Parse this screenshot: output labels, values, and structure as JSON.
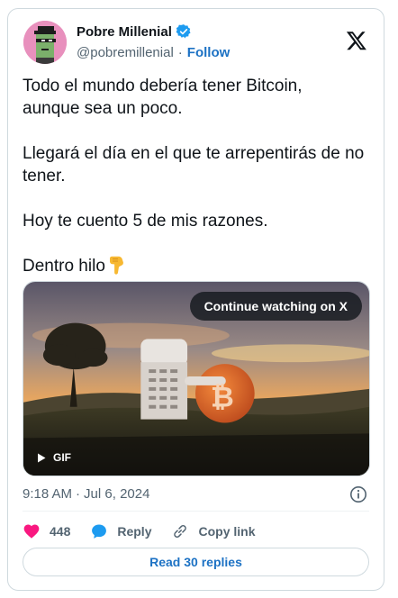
{
  "author": {
    "name": "Pobre Millenial",
    "handle": "@pobremillenial",
    "separator": "·",
    "follow_label": "Follow",
    "verified": true,
    "avatar_icon": "pixel-art-avatar"
  },
  "tweet": {
    "paragraphs": [
      "Todo el mundo debería tener Bitcoin,\naunque sea un poco.",
      "Llegará el día en el que te arrepentirás de no\ntener.",
      "Hoy te cuento 5 de mis razones.",
      "Dentro hilo"
    ],
    "emoji": "backhand-index-pointing-down"
  },
  "media": {
    "type": "gif",
    "gif_label": "GIF",
    "continue_label": "Continue watching on X",
    "description_icon": "bitcoin-coin-scene"
  },
  "meta": {
    "time": "9:18 AM",
    "date_separator": "·",
    "date": "Jul 6, 2024"
  },
  "actions": {
    "likes_count": "448",
    "reply_label": "Reply",
    "copy_link_label": "Copy link",
    "read_replies_label": "Read 30 replies"
  },
  "colors": {
    "accent": "#1d72c4",
    "like": "#f91880",
    "verified": "#1d9bf0",
    "muted": "#536471",
    "border": "#cfd9de"
  }
}
